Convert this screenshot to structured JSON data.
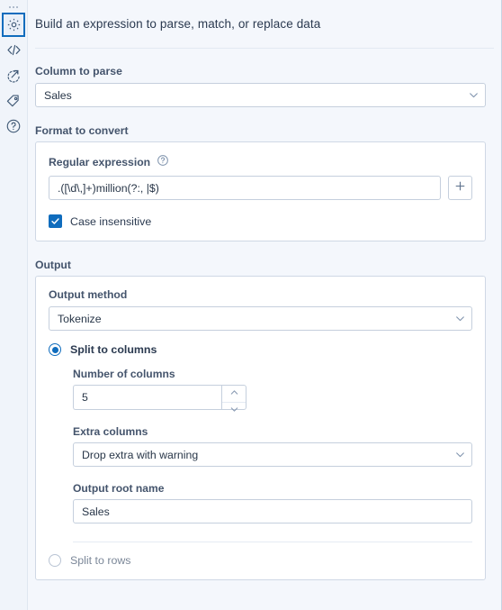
{
  "rail": {
    "items": [
      {
        "name": "grip-handle-icon",
        "label": "Drag handle"
      },
      {
        "name": "gear-icon",
        "label": "Settings",
        "selected": true
      },
      {
        "name": "code-brackets-icon",
        "label": "Code"
      },
      {
        "name": "refresh-arrow-icon",
        "label": "Refresh"
      },
      {
        "name": "tag-icon",
        "label": "Tag"
      },
      {
        "name": "help-question-icon",
        "label": "Help"
      }
    ]
  },
  "header": {
    "title": "Build an expression to parse, match, or replace data"
  },
  "column_to_parse": {
    "label": "Column to parse",
    "value": "Sales",
    "chevron": "chevron-down-icon"
  },
  "format_to_convert": {
    "label": "Format to convert",
    "regex": {
      "label": "Regular expression",
      "help_icon": "help-question-icon",
      "value": ".([\\d\\,]+)million(?:, |$)",
      "add_button": "+"
    },
    "case_insensitive": {
      "label": "Case insensitive",
      "checked": true
    }
  },
  "output": {
    "label": "Output",
    "method": {
      "label": "Output method",
      "value": "Tokenize",
      "chevron": "chevron-down-icon"
    },
    "split_to_columns": {
      "label": "Split to columns",
      "selected": true,
      "number_of_columns": {
        "label": "Number of columns",
        "value": "5"
      },
      "extra_columns": {
        "label": "Extra columns",
        "value": "Drop extra with warning",
        "chevron": "chevron-down-icon"
      },
      "output_root_name": {
        "label": "Output root name",
        "value": "Sales"
      }
    },
    "split_to_rows": {
      "label": "Split to rows",
      "selected": false
    }
  },
  "colors": {
    "accent": "#0f6cbd",
    "background": "#f4f7fc",
    "card": "#ffffff",
    "border": "#c5cfdd",
    "label_text": "#44546c",
    "value_text": "#283648"
  }
}
